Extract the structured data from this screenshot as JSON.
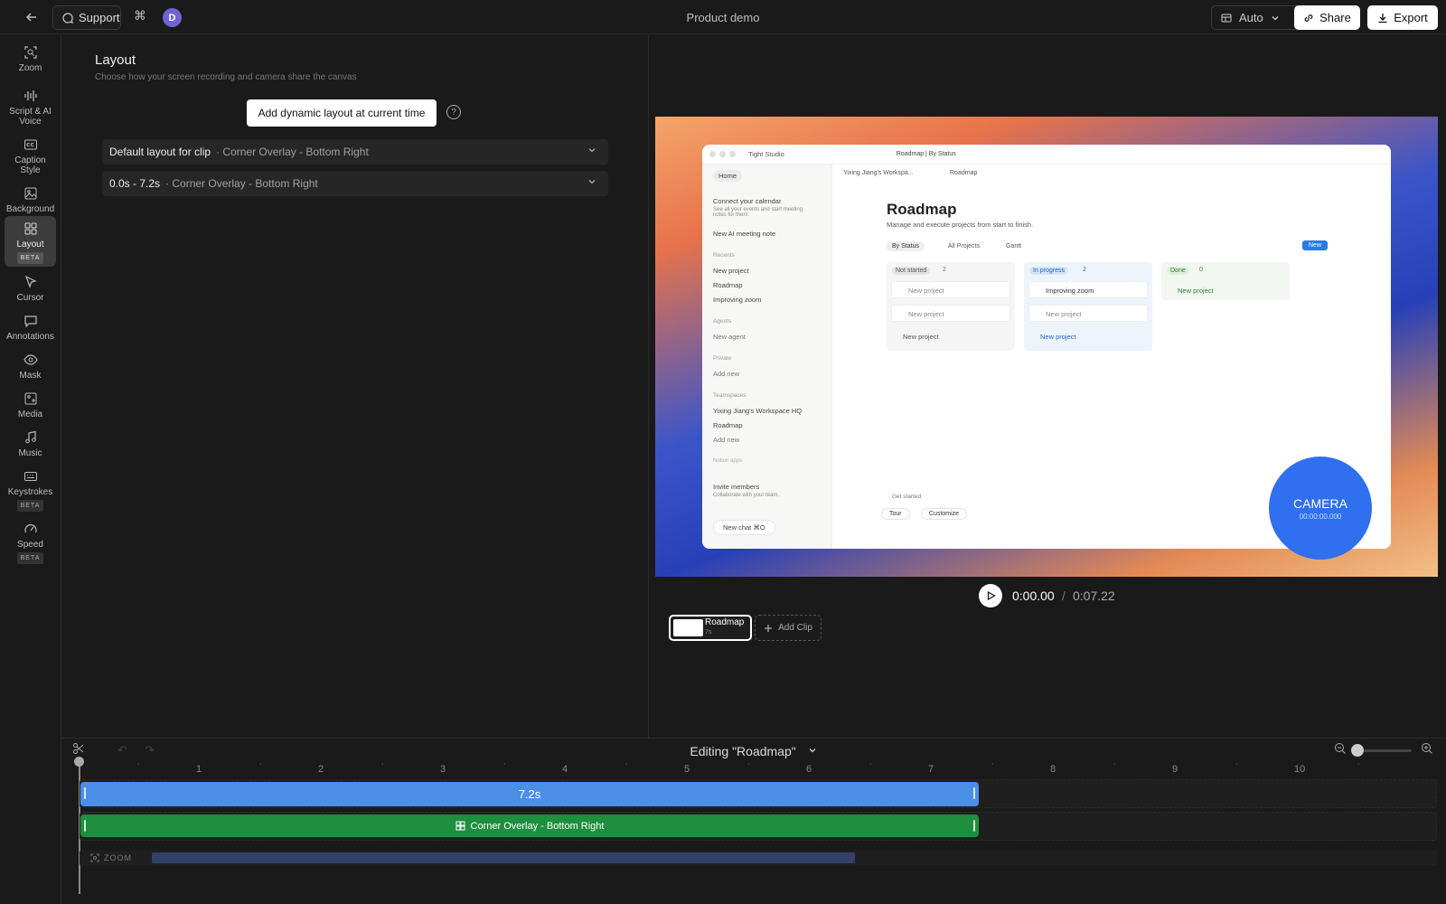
{
  "topbar": {
    "support_label": "Support",
    "avatar_initial": "D",
    "title": "Product demo",
    "auto_label": "Auto",
    "share_label": "Share",
    "export_label": "Export"
  },
  "sidebar": {
    "items": [
      {
        "label": "Zoom",
        "icon": "zoom-icon"
      },
      {
        "label": "Script & AI Voice",
        "icon": "waveform-icon"
      },
      {
        "label": "Caption Style",
        "icon": "caption-icon"
      },
      {
        "label": "Background",
        "icon": "image-icon"
      },
      {
        "label": "Layout",
        "icon": "grid-icon",
        "badge": "BETA",
        "active": true
      },
      {
        "label": "Cursor",
        "icon": "cursor-icon"
      },
      {
        "label": "Annotations",
        "icon": "comment-icon"
      },
      {
        "label": "Mask",
        "icon": "eye-icon"
      },
      {
        "label": "Media",
        "icon": "media-icon"
      },
      {
        "label": "Music",
        "icon": "music-icon"
      },
      {
        "label": "Keystrokes",
        "icon": "keyboard-icon",
        "badge": "BETA"
      },
      {
        "label": "Speed",
        "icon": "speedometer-icon",
        "badge": "BETA"
      }
    ]
  },
  "panel": {
    "title": "Layout",
    "subtitle": "Choose how your screen recording and camera share the canvas",
    "add_button": "Add dynamic layout at current time",
    "rows": [
      {
        "label": "Default layout for clip",
        "value": "· Corner Overlay - Bottom Right"
      },
      {
        "label": "0.0s - 7.2s",
        "value": "· Corner Overlay - Bottom Right"
      }
    ]
  },
  "preview": {
    "app_name": "Tight Studio",
    "tab": "Roadmap | By Status",
    "breadcrumb_ws": "Yixing Jiang's Workspa...",
    "breadcrumb_page": "Roadmap",
    "heading": "Roadmap",
    "heading_sub": "Manage and execute projects from start to finish.",
    "views": [
      "By Status",
      "All Projects",
      "Gantt"
    ],
    "new_label": "New",
    "side": {
      "home": "Home",
      "connect_cal": "Connect your calendar",
      "connect_cal_sub": "See all your events and start meeting notes for them.",
      "new_meeting": "New AI meeting note",
      "recents_h": "Recents",
      "recents": [
        "New project",
        "Roadmap",
        "Improving zoom"
      ],
      "agents_h": "Agents",
      "new_agent": "New agent",
      "private_h": "Private",
      "add_new": "Add new",
      "teamspaces_h": "Teamspaces",
      "workspace": "Yixing Jiang's Workspace HQ",
      "roadmap": "Roadmap",
      "add_new2": "Add new",
      "notion_apps": "Notion apps",
      "invite": "Invite members",
      "invite_sub": "Collaborate with your team.",
      "new_chat": "New chat ⌘O"
    },
    "columns": [
      {
        "status": "Not started",
        "count": "2",
        "cards": [
          "New project",
          "New project"
        ],
        "footer": "New project"
      },
      {
        "status": "In progress",
        "count": "2",
        "cards": [
          "Improving zoom",
          "New project"
        ],
        "footer": "New project"
      },
      {
        "status": "Done",
        "count": "0",
        "cards": [],
        "footer": "New project"
      }
    ],
    "get_started": "Get started",
    "tour": "Tour",
    "customize": "Customize",
    "camera_label": "CAMERA",
    "camera_time": "00:00:00.000"
  },
  "player": {
    "current": "0:00.00",
    "sep": "/",
    "total": "0:07.22",
    "clip_name": "Roadmap",
    "clip_len": "7s",
    "add_clip": "Add Clip"
  },
  "timeline": {
    "editing": "Editing \"Roadmap\"",
    "ticks": [
      "1",
      "2",
      "3",
      "4",
      "5",
      "6",
      "7",
      "8",
      "9",
      "10"
    ],
    "clip_bar": "7.2s",
    "layout_bar": "Corner Overlay - Bottom Right",
    "zoom_label": "ZOOM",
    "clip_seconds": 7.2,
    "zoom_seconds": 6.2
  }
}
